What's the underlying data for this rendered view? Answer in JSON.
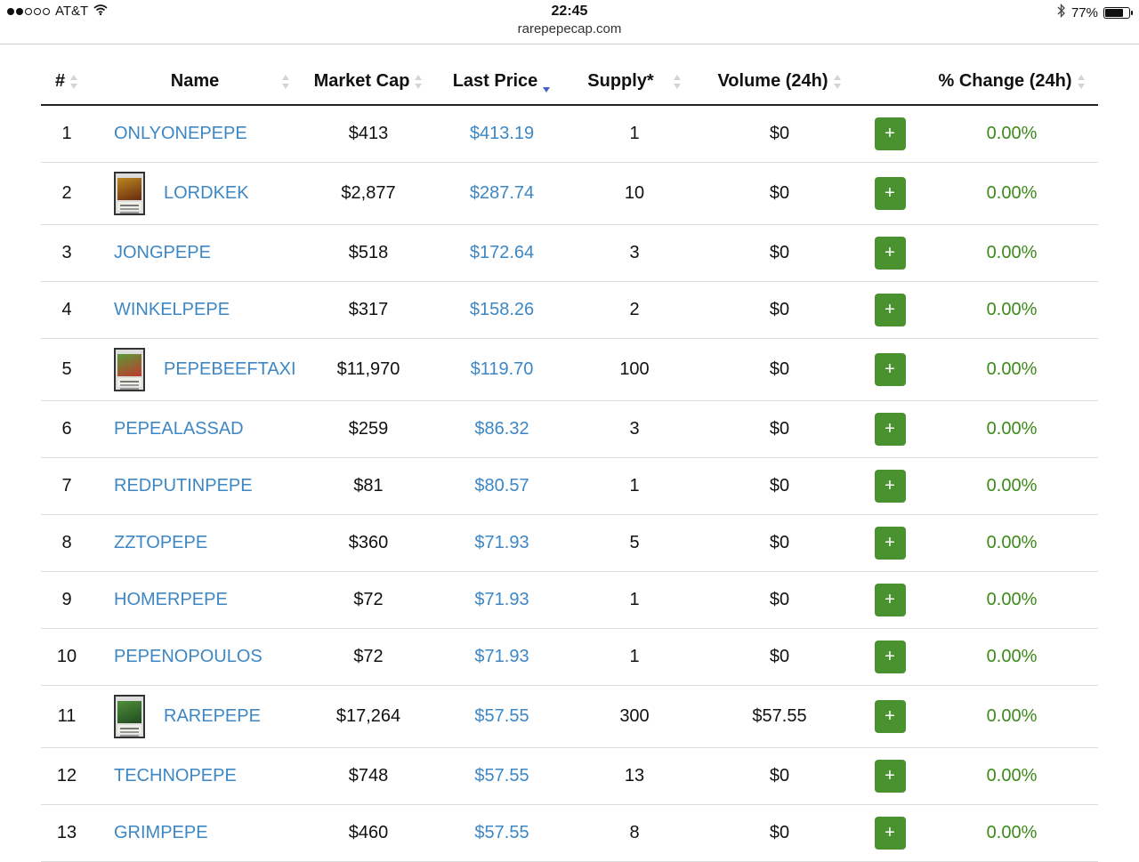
{
  "status_bar": {
    "carrier": "AT&T",
    "time": "22:45",
    "battery": "77%",
    "battery_level": 0.77,
    "signal_bars_filled": 2,
    "signal_bars_total": 5
  },
  "url": "rarepepecap.com",
  "table": {
    "columns": [
      "#",
      "Name",
      "Market Cap",
      "Last Price",
      "Supply*",
      "Volume (24h)",
      "% Change (24h)"
    ],
    "sorted_column": "Last Price",
    "sort_direction": "descending",
    "add_button_label": "+",
    "rows": [
      {
        "rank": "1",
        "name": "ONLYONEPEPE",
        "has_card": false,
        "market_cap": "$413",
        "last_price": "$413.19",
        "supply": "1",
        "volume": "$0",
        "change": "0.00%"
      },
      {
        "rank": "2",
        "name": "LORDKEK",
        "has_card": true,
        "card_colors": [
          "#b8871f",
          "#6b2a10"
        ],
        "market_cap": "$2,877",
        "last_price": "$287.74",
        "supply": "10",
        "volume": "$0",
        "change": "0.00%"
      },
      {
        "rank": "3",
        "name": "JONGPEPE",
        "has_card": false,
        "market_cap": "$518",
        "last_price": "$172.64",
        "supply": "3",
        "volume": "$0",
        "change": "0.00%"
      },
      {
        "rank": "4",
        "name": "WINKELPEPE",
        "has_card": false,
        "market_cap": "$317",
        "last_price": "$158.26",
        "supply": "2",
        "volume": "$0",
        "change": "0.00%"
      },
      {
        "rank": "5",
        "name": "PEPEBEEFTAXI",
        "has_card": true,
        "card_colors": [
          "#5a9a3a",
          "#c0392b"
        ],
        "market_cap": "$11,970",
        "last_price": "$119.70",
        "supply": "100",
        "volume": "$0",
        "change": "0.00%"
      },
      {
        "rank": "6",
        "name": "PEPEALASSAD",
        "has_card": false,
        "market_cap": "$259",
        "last_price": "$86.32",
        "supply": "3",
        "volume": "$0",
        "change": "0.00%"
      },
      {
        "rank": "7",
        "name": "REDPUTINPEPE",
        "has_card": false,
        "market_cap": "$81",
        "last_price": "$80.57",
        "supply": "1",
        "volume": "$0",
        "change": "0.00%"
      },
      {
        "rank": "8",
        "name": "ZZTOPEPE",
        "has_card": false,
        "market_cap": "$360",
        "last_price": "$71.93",
        "supply": "5",
        "volume": "$0",
        "change": "0.00%"
      },
      {
        "rank": "9",
        "name": "HOMERPEPE",
        "has_card": false,
        "market_cap": "$72",
        "last_price": "$71.93",
        "supply": "1",
        "volume": "$0",
        "change": "0.00%"
      },
      {
        "rank": "10",
        "name": "PEPENOPOULOS",
        "has_card": false,
        "market_cap": "$72",
        "last_price": "$71.93",
        "supply": "1",
        "volume": "$0",
        "change": "0.00%"
      },
      {
        "rank": "11",
        "name": "RAREPEPE",
        "has_card": true,
        "card_colors": [
          "#4f8f3a",
          "#1f4a1f"
        ],
        "market_cap": "$17,264",
        "last_price": "$57.55",
        "supply": "300",
        "volume": "$57.55",
        "change": "0.00%"
      },
      {
        "rank": "12",
        "name": "TECHNOPEPE",
        "has_card": false,
        "market_cap": "$748",
        "last_price": "$57.55",
        "supply": "13",
        "volume": "$0",
        "change": "0.00%"
      },
      {
        "rank": "13",
        "name": "GRIMPEPE",
        "has_card": false,
        "market_cap": "$460",
        "last_price": "$57.55",
        "supply": "8",
        "volume": "$0",
        "change": "0.00%"
      }
    ]
  },
  "colors": {
    "link": "#3d87c4",
    "positive_change": "#3d8a1a",
    "add_button": "#4a9130",
    "sort_active": "#4a63c2"
  }
}
